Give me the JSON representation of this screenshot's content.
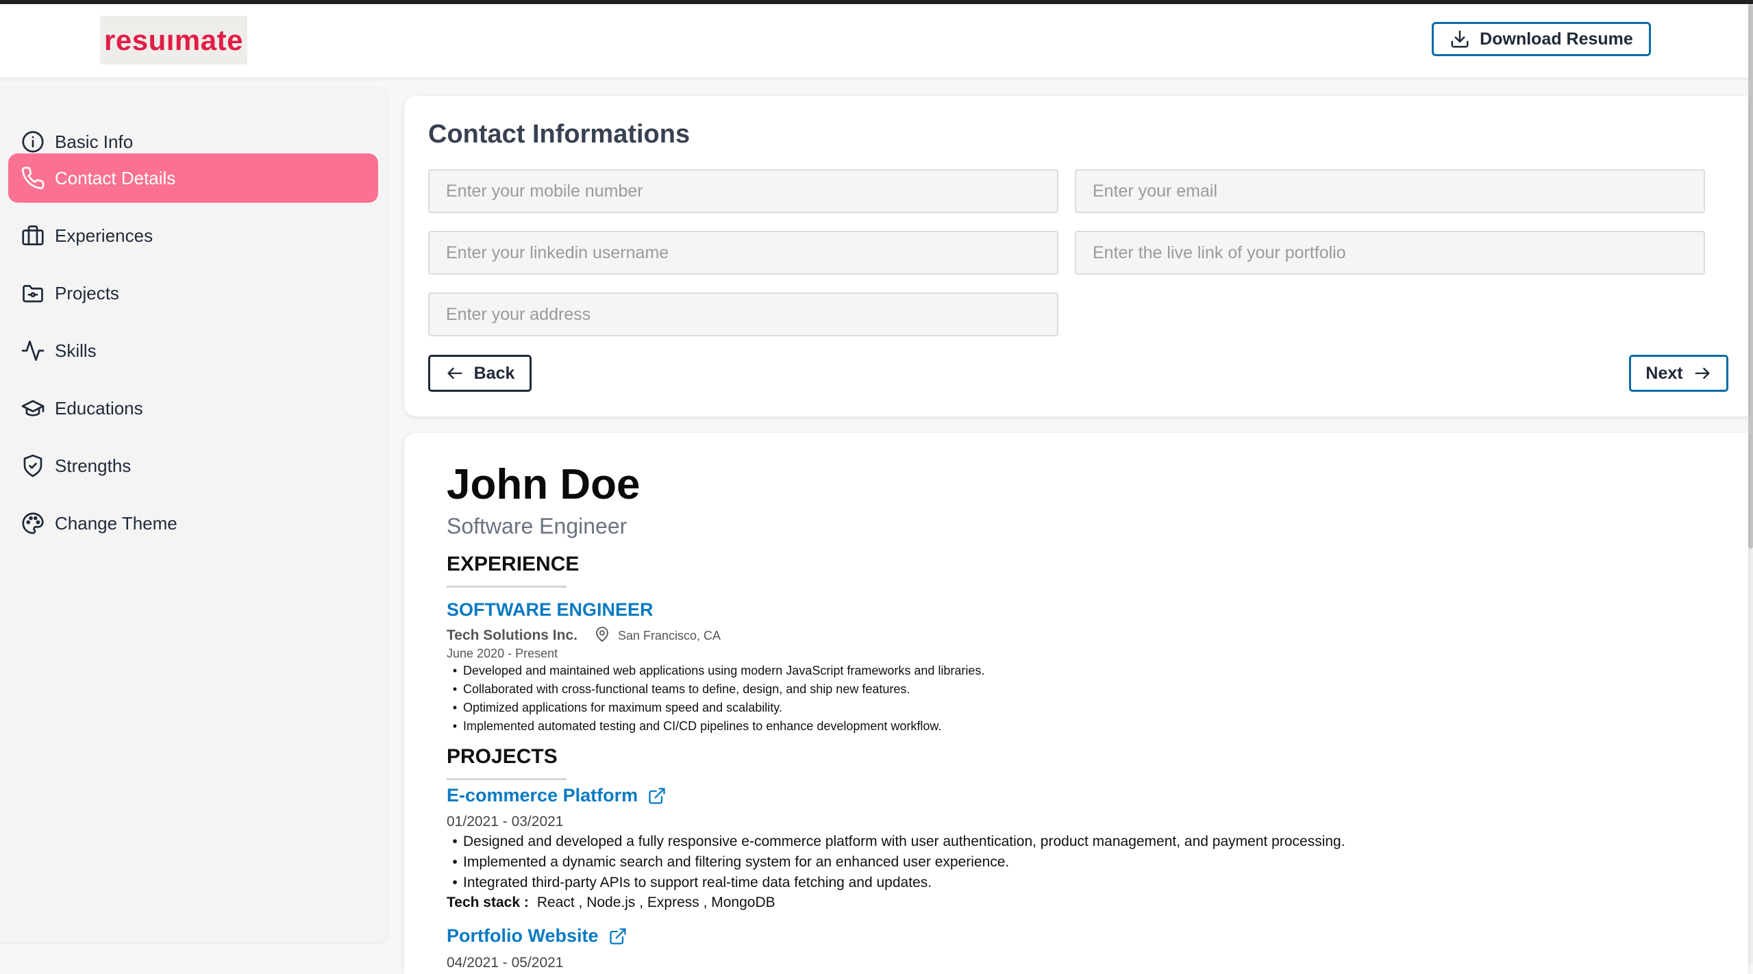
{
  "header": {
    "logo_text": "resuımate",
    "download_label": "Download  Resume"
  },
  "sidebar": {
    "items": [
      {
        "label": "Basic Info",
        "icon": "info-circle-icon"
      },
      {
        "label": "Contact Details",
        "icon": "phone-icon",
        "active": true
      },
      {
        "label": "Experiences",
        "icon": "briefcase-icon"
      },
      {
        "label": "Projects",
        "icon": "folder-icon"
      },
      {
        "label": "Skills",
        "icon": "activity-icon"
      },
      {
        "label": "Educations",
        "icon": "graduation-cap-icon"
      },
      {
        "label": "Strengths",
        "icon": "shield-check-icon"
      },
      {
        "label": "Change Theme",
        "icon": "palette-icon"
      }
    ]
  },
  "contact_form": {
    "title": "Contact Informations",
    "fields": {
      "mobile": {
        "placeholder": "Enter your mobile number",
        "value": ""
      },
      "email": {
        "placeholder": "Enter your email",
        "value": ""
      },
      "linkedin": {
        "placeholder": "Enter your linkedin username",
        "value": ""
      },
      "portfolio": {
        "placeholder": "Enter the live link of your portfolio",
        "value": ""
      },
      "address": {
        "placeholder": "Enter your address",
        "value": ""
      }
    },
    "back_label": "Back",
    "next_label": "Next"
  },
  "resume": {
    "name": "John Doe",
    "role": "Software Engineer",
    "experience_heading": "EXPERIENCE",
    "job": {
      "title": "SOFTWARE ENGINEER",
      "company": "Tech Solutions Inc.",
      "location": "San Francisco, CA",
      "dates": "June 2020 - Present",
      "bullets": [
        "Developed and maintained web applications using modern JavaScript frameworks and libraries.",
        "Collaborated with cross-functional teams to define, design, and ship new features.",
        "Optimized applications for maximum speed and scalability.",
        "Implemented automated testing and CI/CD pipelines to enhance development workflow."
      ]
    },
    "projects_heading": "PROJECTS",
    "projects": [
      {
        "title": "E-commerce Platform",
        "dates": "01/2021 - 03/2021",
        "bullets": [
          "Designed and developed a fully responsive e-commerce platform with user authentication, product management, and payment processing.",
          "Implemented a dynamic search and filtering system for an enhanced user experience.",
          "Integrated third-party APIs to support real-time data fetching and updates."
        ],
        "tech_label": "Tech stack :",
        "tech": "React , Node.js , Express , MongoDB"
      },
      {
        "title": "Portfolio Website",
        "dates": "04/2021 - 05/2021"
      }
    ]
  },
  "colors": {
    "accent_pink": "#fb7191",
    "brand_red": "#e11d48",
    "link_blue": "#0a7ac2",
    "button_border_blue": "#0b6aa8"
  }
}
